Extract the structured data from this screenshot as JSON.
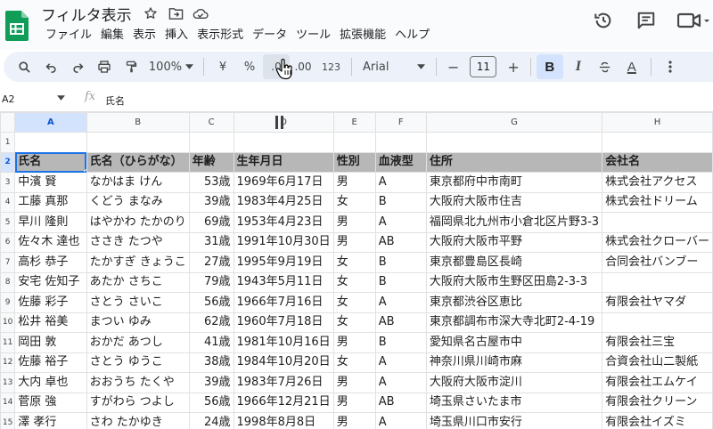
{
  "doc_title": "フィルタ表示",
  "menu": [
    "ファイル",
    "編集",
    "表示",
    "挿入",
    "表示形式",
    "データ",
    "ツール",
    "拡張機能",
    "ヘルプ"
  ],
  "toolbar": {
    "zoom": "100%",
    "currency": "¥",
    "percent": "%",
    "dec_decrease": ".0",
    "dec_increase": ".00",
    "number_format": "123",
    "font": "Arial",
    "minus": "−",
    "font_size": "11",
    "plus": "+",
    "bold": "B",
    "italic": "I",
    "text_color": "A"
  },
  "formula_bar": {
    "name_box": "A2",
    "fx": "fx",
    "content": "氏名"
  },
  "columns": [
    "A",
    "B",
    "C",
    "D",
    "E",
    "F",
    "G",
    "H"
  ],
  "rows": [
    {
      "n": "1",
      "cells": [
        "",
        "",
        "",
        "",
        "",
        "",
        "",
        ""
      ]
    },
    {
      "n": "2",
      "cells": [
        "氏名",
        "氏名（ひらがな）",
        "年齢",
        "生年月日",
        "性別",
        "血液型",
        "住所",
        "会社名"
      ]
    },
    {
      "n": "3",
      "cells": [
        "中濱 賢",
        "なかはま けん",
        "53歳",
        "1969年6月17日",
        "男",
        "A",
        "東京都府中市南町",
        "株式会社アクセス"
      ]
    },
    {
      "n": "4",
      "cells": [
        "工藤 真那",
        "くどう まなみ",
        "39歳",
        "1983年4月25日",
        "女",
        "B",
        "大阪府大阪市住吉",
        "株式会社ドリーム"
      ]
    },
    {
      "n": "5",
      "cells": [
        "早川 隆則",
        "はやかわ たかのり",
        "69歳",
        "1953年4月23日",
        "男",
        "A",
        "福岡県北九州市小倉北区片野3-3",
        ""
      ]
    },
    {
      "n": "6",
      "cells": [
        "佐々木 達也",
        "ささき たつや",
        "31歳",
        "1991年10月30日",
        "男",
        "AB",
        "大阪府大阪市平野",
        "株式会社クローバー"
      ]
    },
    {
      "n": "7",
      "cells": [
        "高杉 恭子",
        "たかすぎ きょうこ",
        "27歳",
        "1995年9月19日",
        "女",
        "B",
        "東京都豊島区長崎",
        "合同会社バンブー"
      ]
    },
    {
      "n": "8",
      "cells": [
        "安宅 佐知子",
        "あたか さちこ",
        "79歳",
        "1943年5月11日",
        "女",
        "B",
        "大阪府大阪市生野区田島2-3-3",
        ""
      ]
    },
    {
      "n": "9",
      "cells": [
        "佐藤 彩子",
        "さとう さいこ",
        "56歳",
        "1966年7月16日",
        "女",
        "A",
        "東京都渋谷区恵比",
        "有限会社ヤマダ"
      ]
    },
    {
      "n": "10",
      "cells": [
        "松井 裕美",
        "まつい ゆみ",
        "62歳",
        "1960年7月18日",
        "女",
        "AB",
        "東京都調布市深大寺北町2-4-19",
        ""
      ]
    },
    {
      "n": "11",
      "cells": [
        "岡田 敦",
        "おかだ あつし",
        "41歳",
        "1981年10月16日",
        "男",
        "B",
        "愛知県名古屋市中",
        "有限会社三宝"
      ]
    },
    {
      "n": "12",
      "cells": [
        "佐藤 裕子",
        "さとう ゆうこ",
        "38歳",
        "1984年10月20日",
        "女",
        "A",
        "神奈川県川崎市麻",
        "合資会社山二製紙"
      ]
    },
    {
      "n": "13",
      "cells": [
        "大内 卓也",
        "おおうち たくや",
        "39歳",
        "1983年7月26日",
        "男",
        "A",
        "大阪府大阪市淀川",
        "有限会社エムケイ"
      ]
    },
    {
      "n": "14",
      "cells": [
        "菅原 強",
        "すがわら つよし",
        "56歳",
        "1966年12月21日",
        "男",
        "AB",
        "埼玉県さいたま市",
        "有限会社クリーン"
      ]
    },
    {
      "n": "15",
      "cells": [
        "澤 孝行",
        "さわ たかゆき",
        "24歳",
        "1998年8月8日",
        "男",
        "A",
        "埼玉県川口市安行",
        "有限会社イズミ"
      ]
    }
  ],
  "colors": {
    "accent": "#1a73e8",
    "header_fill": "#b7b7b7",
    "selected_header": "#d3e3fd",
    "sheets_green": "#0f9d58"
  }
}
